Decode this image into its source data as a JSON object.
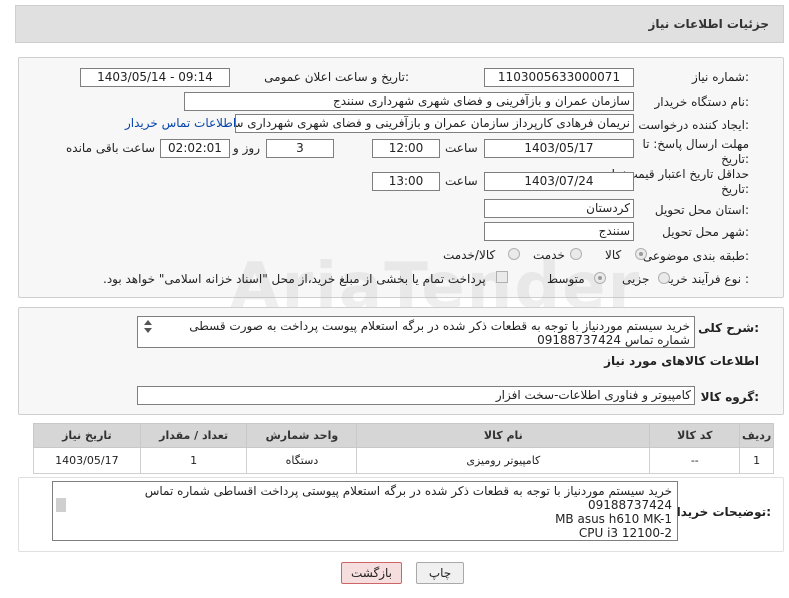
{
  "header": {
    "title": "جزئیات اطلاعات نیاز"
  },
  "form": {
    "need_number_label": "شماره نیاز:",
    "need_number": "1103005633000071",
    "announce_label": "تاریخ و ساعت اعلان عمومی:",
    "announce_value": "1403/05/14 - 09:14",
    "buyer_org_label": "نام دستگاه خریدار:",
    "buyer_org": "سازمان عمران و بازآفرینی و فضای شهری شهرداری سنندج",
    "requester_label": "ایجاد کننده درخواست:",
    "requester": "نریمان فرهادی کارپرداز سازمان عمران و بازآفرینی و فضای شهری شهرداری سنندج",
    "contact_link": "اطلاعات تماس خریدار",
    "deadline_label": "مهلت ارسال پاسخ: تا",
    "deadline_label2": "تاریخ:",
    "deadline_date": "1403/05/17",
    "time_label": "ساعت",
    "deadline_time": "12:00",
    "days_value": "3",
    "days_label": "روز و",
    "remaining_time": "02:02:01",
    "remaining_label": "ساعت باقی مانده",
    "validity_label": "حداقل تاریخ اعتبار قیمت: تا",
    "validity_label2": "تاریخ:",
    "validity_date": "1403/07/24",
    "validity_time": "13:00",
    "province_label": "استان محل تحویل:",
    "province": "کردستان",
    "city_label": "شهر محل تحویل:",
    "city": "سنندج",
    "category_label": "طبقه بندی موضوعی:",
    "category_options": [
      "کالا",
      "خدمت",
      "کالا/خدمت"
    ],
    "process_label": "نوع فرآیند خرید :",
    "process_options": [
      "جزیی",
      "متوسط"
    ],
    "payment_note": "پرداخت تمام یا بخشی از مبلغ خرید،از محل \"اسناد خزانه اسلامی\" خواهد بود."
  },
  "description": {
    "label": "شرح کلی نیاز:",
    "text_line1": "خرید سیستم موردنیاز  با توجه به قطعات ذکر شده در برگه استعلام پیوست پرداخت به صورت قسطی",
    "text_line2": "شماره تماس 09188737424"
  },
  "goods": {
    "section_title": "اطلاعات کالاهای مورد نیاز",
    "group_label": "گروه کالا:",
    "group_value": "کامپیوتر و فناوری اطلاعات-سخت افزار",
    "columns": [
      "ردیف",
      "کد کالا",
      "نام کالا",
      "واحد شمارش",
      "تعداد / مقدار",
      "تاریخ نیاز"
    ],
    "rows": [
      {
        "row": "1",
        "code": "--",
        "name": "کامپیوتر رومیزی",
        "unit": "دستگاه",
        "qty": "1",
        "date": "1403/05/17"
      }
    ]
  },
  "buyer_notes": {
    "label": "توضیحات خریدار:",
    "lines": [
      "خرید سیستم موردنیاز  با توجه به قطعات ذکر شده در برگه استعلام پیوستی پرداخت اقساطی شماره تماس",
      "09188737424",
      "MB asus h610 MK-1",
      "CPU i3 12100-2"
    ]
  },
  "buttons": {
    "print": "چاپ",
    "back": "بازگشت"
  }
}
